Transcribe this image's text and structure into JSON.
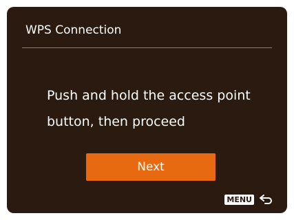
{
  "dialog": {
    "title": "WPS Connection",
    "message_line1": "Push and hold the access point",
    "message_line2": "button, then proceed",
    "next_label": "Next"
  },
  "footer": {
    "menu_label": "MENU",
    "back_icon": "return-arrow-icon"
  },
  "colors": {
    "background": "#2a1a0f",
    "accent": "#e86a10",
    "text": "#ffffff",
    "divider": "#8a7d72"
  }
}
